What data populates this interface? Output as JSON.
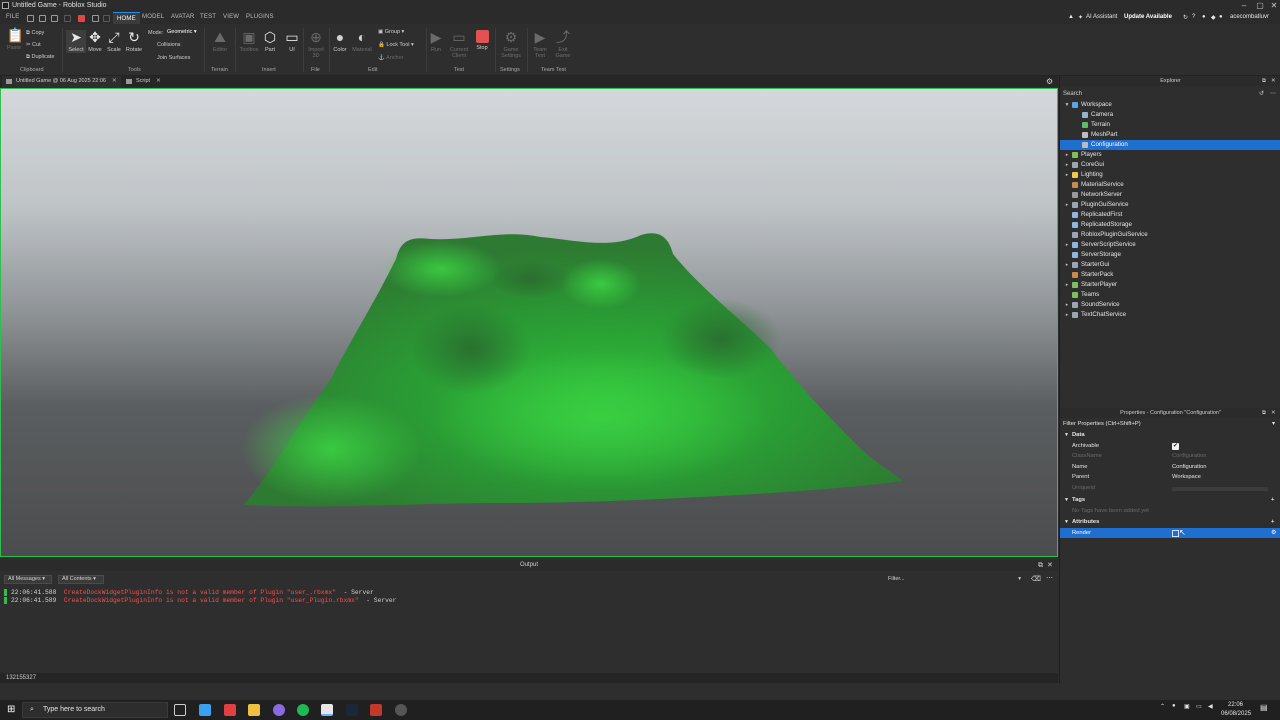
{
  "window": {
    "title": "Untitled Game - Roblox Studio"
  },
  "menubar": {
    "file": "FILE",
    "tabs": [
      "HOME",
      "MODEL",
      "AVATAR",
      "TEST",
      "VIEW",
      "PLUGINS"
    ],
    "active_tab": "HOME",
    "ai_assistant": "AI Assistant",
    "update": "Update Available",
    "username": "acecombatluvr"
  },
  "ribbon": {
    "clipboard": {
      "paste": "Paste",
      "copy": "Copy",
      "cut": "Cut",
      "duplicate": "Duplicate",
      "group": "Clipboard"
    },
    "tools": {
      "select": "Select",
      "move": "Move",
      "scale": "Scale",
      "rotate": "Rotate",
      "mode_label": "Mode:",
      "mode_value": "Geometric",
      "collisions": "Collisions",
      "join_surfaces": "Join Surfaces",
      "group": "Tools"
    },
    "terrain": {
      "editor": "Editor",
      "group": "Terrain"
    },
    "insert": {
      "toolbox": "Toolbox",
      "part": "Part",
      "ui": "UI",
      "group": "Insert"
    },
    "file": {
      "import3d": "Import 3D",
      "group": "File"
    },
    "edit": {
      "color": "Color",
      "material": "Material",
      "group_btn": "Group",
      "lock_tool": "Lock Tool",
      "anchor": "Anchor",
      "group": "Edit"
    },
    "test": {
      "run": "Run",
      "current_client": "Current Client",
      "stop": "Stop",
      "group": "Test"
    },
    "settings": {
      "game_settings": "Game Settings",
      "group": "Settings"
    },
    "teamtest": {
      "team_test": "Team Test",
      "exit_game": "Exit Game",
      "group": "Team Test"
    }
  },
  "doc_tabs": [
    {
      "label": "Untitled Game @ 06 Aug 2025 22:06"
    },
    {
      "label": "Script"
    }
  ],
  "output": {
    "title": "Output",
    "filter_messages": "All Messages",
    "filter_contexts": "All Contents",
    "filter_placeholder": "Filter...",
    "lines": [
      {
        "time": "22:06:41.588",
        "msg": "CreateDockWidgetPluginInfo is not a valid member of Plugin \"user_.rbxmx\"",
        "ctx": "- Server"
      },
      {
        "time": "22:06:41.589",
        "msg": "CreateDockWidgetPluginInfo is not a valid member of Plugin \"user_Plugin.rbxmx\"",
        "ctx": "- Server"
      }
    ]
  },
  "statusbar": {
    "text": "132155327"
  },
  "explorer": {
    "title": "Explorer",
    "search_placeholder": "Search",
    "items": [
      {
        "label": "Workspace",
        "icon_color": "#5aa3e8"
      },
      {
        "label": "Camera",
        "icon_color": "#9ab2c9"
      },
      {
        "label": "Terrain",
        "icon_color": "#5dbb6a"
      },
      {
        "label": "MeshPart",
        "icon_color": "#bdbdbd"
      },
      {
        "label": "Configuration",
        "icon_color": "#bcbcbc"
      },
      {
        "label": "Players",
        "icon_color": "#7fbf5f"
      },
      {
        "label": "CoreGui",
        "icon_color": "#9aa6b2"
      },
      {
        "label": "Lighting",
        "icon_color": "#f0c94a"
      },
      {
        "label": "MaterialService",
        "icon_color": "#c98a4b"
      },
      {
        "label": "NetworkServer",
        "icon_color": "#9a9a9a"
      },
      {
        "label": "PluginGuiService",
        "icon_color": "#9aa6b2"
      },
      {
        "label": "ReplicatedFirst",
        "icon_color": "#8fb5e0"
      },
      {
        "label": "ReplicatedStorage",
        "icon_color": "#8fb5e0"
      },
      {
        "label": "RobloxPluginGuiService",
        "icon_color": "#9aa6b2"
      },
      {
        "label": "ServerScriptService",
        "icon_color": "#8fb5e0"
      },
      {
        "label": "ServerStorage",
        "icon_color": "#8fb5e0"
      },
      {
        "label": "StarterGui",
        "icon_color": "#9aa6b2"
      },
      {
        "label": "StarterPack",
        "icon_color": "#c98a4b"
      },
      {
        "label": "StarterPlayer",
        "icon_color": "#7fbf5f"
      },
      {
        "label": "Teams",
        "icon_color": "#7fbf5f"
      },
      {
        "label": "SoundService",
        "icon_color": "#9aa6b2"
      },
      {
        "label": "TextChatService",
        "icon_color": "#9aa6b2"
      }
    ]
  },
  "properties": {
    "title": "Properties - Configuration \"Configuration\"",
    "filter": "Filter Properties (Ctrl+Shift+P)",
    "data_section": "Data",
    "archivable": "Archivable",
    "classname_k": "ClassName",
    "classname_v": "Configuration",
    "name_k": "Name",
    "name_v": "Configuration",
    "parent_k": "Parent",
    "parent_v": "Workspace",
    "uniqueid_k": "UniqueId",
    "tags_section": "Tags",
    "tags_empty": "No Tags have been added yet",
    "attributes_section": "Attributes",
    "render_attr": "Render"
  },
  "taskbar": {
    "search": "Type here to search",
    "time": "22:06",
    "date": "06/08/2025"
  }
}
